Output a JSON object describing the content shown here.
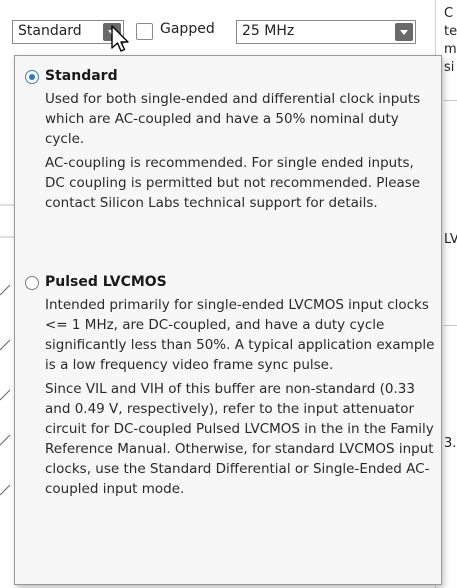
{
  "toolbar": {
    "mode_value": "Standard",
    "gapped_label": "Gapped",
    "frequency_value": "25 MHz"
  },
  "background": {
    "right_fragments": [
      "C",
      "te",
      "m",
      "si",
      "LV",
      "3."
    ]
  },
  "popup": {
    "options": [
      {
        "title": "Standard",
        "selected": true,
        "paragraphs": [
          "Used for both single-ended and differential clock inputs which are AC-coupled and have a 50% nominal duty cycle.",
          "AC-coupling is recommended. For single ended inputs, DC coupling is permitted but not recommended. Please contact Silicon Labs technical support for details."
        ]
      },
      {
        "title": "Pulsed LVCMOS",
        "selected": false,
        "paragraphs": [
          "Intended primarily for single-ended LVCMOS input clocks <= 1 MHz, are DC-coupled, and have a duty cycle significantly less than 50%. A typical application example is a low frequency video frame sync pulse.",
          "Since VIL and VIH of this buffer are non-standard (0.33 and 0.49 V, respectively), refer to the input attenuator circuit for DC-coupled Pulsed LVCMOS in the in the Family Reference Manual. Otherwise, for standard LVCMOS input clocks, use the Standard Differential or Single-Ended AC-coupled input mode."
        ]
      }
    ]
  },
  "colors": {
    "accent_radio": "#2e78c7",
    "combo_arrow": "#6a6a6a",
    "popup_bg": "#f7f7f7"
  }
}
